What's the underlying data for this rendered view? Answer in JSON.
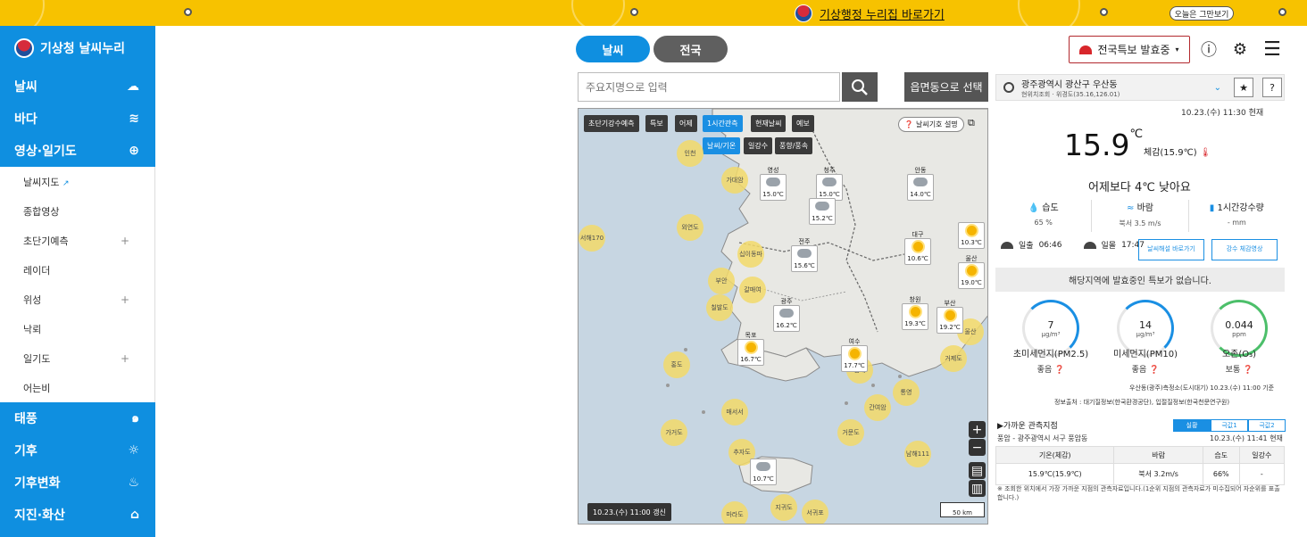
{
  "topbar": {
    "link_text": "기상행정 누리집 바로가기",
    "close_today": "오늘은 그만보기"
  },
  "sidebar": {
    "logo": "기상청 날씨누리",
    "items": [
      {
        "label": "날씨",
        "icon": "sun-cloud-icon"
      },
      {
        "label": "바다",
        "icon": "wave-icon"
      },
      {
        "label": "영상·일기도",
        "icon": "satellite-icon"
      }
    ],
    "sub_items": [
      {
        "label": "날씨지도",
        "ext": true,
        "plus": false
      },
      {
        "label": "종합영상",
        "ext": false,
        "plus": false
      },
      {
        "label": "초단기예측",
        "ext": false,
        "plus": true
      },
      {
        "label": "레이더",
        "ext": false,
        "plus": false
      },
      {
        "label": "위성",
        "ext": false,
        "plus": true
      },
      {
        "label": "낙뢰",
        "ext": false,
        "plus": false
      },
      {
        "label": "일기도",
        "ext": false,
        "plus": true
      },
      {
        "label": "어는비",
        "ext": false,
        "plus": false
      }
    ],
    "items_after": [
      {
        "label": "태풍",
        "icon": "typhoon-icon"
      },
      {
        "label": "기후",
        "icon": "climate-icon"
      },
      {
        "label": "기후변화",
        "icon": "climate-change-icon"
      },
      {
        "label": "지진·화산",
        "icon": "earthquake-icon"
      }
    ]
  },
  "tabs": [
    "날씨",
    "전국"
  ],
  "search": {
    "placeholder": "주요지명으로 입력",
    "region_button": "읍면동으로 선택"
  },
  "map": {
    "chips_row1": [
      "초단기강수예측",
      "특보",
      "어제",
      "1시간관측",
      "현재날씨",
      "예보"
    ],
    "chips_row2": [
      "날씨/기온",
      "일강수",
      "풍향/풍속"
    ],
    "legend_button": "날씨기호 설명",
    "update_time": "10.23.(수) 11:00 갱신",
    "scale": "50 km",
    "cards": [
      {
        "name": "영성",
        "temp": "15.0℃",
        "icon": "cloud"
      },
      {
        "name": "청주",
        "temp": "15.0℃",
        "icon": "cloud"
      },
      {
        "name": "안동",
        "temp": "14.0℃",
        "icon": "cloud"
      },
      {
        "name": "",
        "temp": "15.2℃",
        "icon": "cloud"
      },
      {
        "name": "전주",
        "temp": "15.6℃",
        "icon": "cloud"
      },
      {
        "name": "대구",
        "temp": "10.6℃",
        "icon": "sun"
      },
      {
        "name": "",
        "temp": "10.3℃",
        "icon": "sun"
      },
      {
        "name": "울산",
        "temp": "19.0℃",
        "icon": "sun"
      },
      {
        "name": "광주",
        "temp": "16.2℃",
        "icon": "cloud"
      },
      {
        "name": "창원",
        "temp": "19.3℃",
        "icon": "sun"
      },
      {
        "name": "부산",
        "temp": "19.2℃",
        "icon": "sun"
      },
      {
        "name": "목포",
        "temp": "16.7℃",
        "icon": "sun"
      },
      {
        "name": "여수",
        "temp": "17.7℃",
        "icon": "sun"
      },
      {
        "name": "",
        "temp": "10.7℃",
        "icon": "cloud"
      }
    ],
    "bubbles": [
      "인천",
      "가대암",
      "외연도",
      "서해170",
      "십이동파",
      "부안",
      "칠발도",
      "갈매여",
      "홍도",
      "매서서",
      "가거도",
      "추자도",
      "마라도",
      "지귀도",
      "서귀포",
      "남해",
      "거문도",
      "간여암",
      "통영",
      "울산",
      "남해111",
      "거제도"
    ]
  },
  "header_right": {
    "warning_button": "전국특보 발효중"
  },
  "location": {
    "name": "광주광역시 광산구 우산동",
    "coord": "현위치조회 · 위경도(35.16,126.01)"
  },
  "current": {
    "time": "10.23.(수) 11:30 현재",
    "temp": "15.9",
    "temp_unit": "℃",
    "feels": "체감(15.9℃)",
    "compare": "어제보다 4℃ 낮아요",
    "stats": [
      {
        "label": "습도",
        "value": "65 %"
      },
      {
        "label": "바람",
        "value": "북서 3.5 m/s"
      },
      {
        "label": "1시간강수량",
        "value": "- mm"
      }
    ],
    "sunrise_label": "일출",
    "sunrise": "06:46",
    "sunset_label": "일몰",
    "sunset": "17:47",
    "btn1": "날씨해설 바로가기",
    "btn2": "강수 체감영상",
    "no_warning": "해당지역에 발효중인 특보가 없습니다."
  },
  "air": [
    {
      "value": "7",
      "unit": "μg/m³",
      "label": "초미세먼지(PM2.5)",
      "grade": "좋음"
    },
    {
      "value": "14",
      "unit": "μg/m³",
      "label": "미세먼지(PM10)",
      "grade": "좋음"
    },
    {
      "value": "0.044",
      "unit": "ppm",
      "label": "오존(O₃)",
      "grade": "보통"
    }
  ],
  "air_source": "우산동(광주)측정소(도시대기) 10.23.(수) 11:00 기준",
  "air_source2": "정보출처 : 대기질정보(한국환경공단), 입절질정보(한국천문연구원)",
  "nearby": {
    "title": "▶가까운 관측지점",
    "tabs": [
      "실황",
      "극값1",
      "극값2"
    ],
    "sub": "풍암 - 광주광역시 서구 풍암동",
    "time": "10.23.(수) 11:41 현재",
    "headers": [
      "기온(체감)",
      "바람",
      "습도",
      "일강수"
    ],
    "row": [
      "15.9℃(15.9℃)",
      "북서 3.2m/s",
      "66%",
      "-"
    ]
  },
  "note": "※ 조회한 위치에서 가장 가까운 지점의 관측자료입니다.(1순위 지점의 관측자료가 미수집되어 자순위를 표출합니다.)"
}
